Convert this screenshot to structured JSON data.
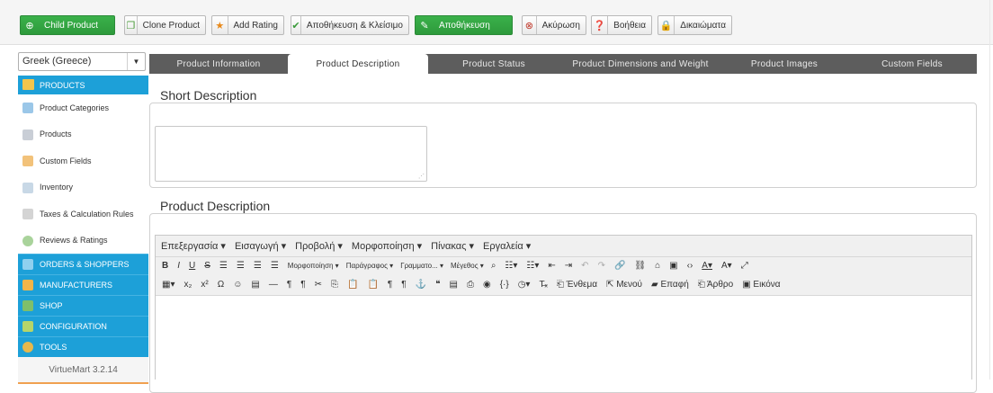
{
  "toolbar": {
    "child_product": "Child Product",
    "clone_product": "Clone Product",
    "add_rating": "Add Rating",
    "save_close": "Αποθήκευση & Κλείσιμο",
    "save": "Αποθήκευση",
    "cancel": "Ακύρωση",
    "help": "Βοήθεια",
    "permissions": "Δικαιώματα"
  },
  "language": {
    "selected": "Greek (Greece)"
  },
  "sidebar": {
    "section_products": "PRODUCTS",
    "items": [
      {
        "label": "Product Categories",
        "icon": "folder-icon"
      },
      {
        "label": "Products",
        "icon": "products-icon"
      },
      {
        "label": "Custom Fields",
        "icon": "custom-fields-icon"
      },
      {
        "label": "Inventory",
        "icon": "inventory-icon"
      },
      {
        "label": "Taxes & Calculation Rules",
        "icon": "calculator-icon"
      },
      {
        "label": "Reviews & Ratings",
        "icon": "reviews-icon"
      }
    ],
    "sections": [
      {
        "label": "ORDERS & SHOPPERS"
      },
      {
        "label": "MANUFACTURERS"
      },
      {
        "label": "SHOP"
      },
      {
        "label": "CONFIGURATION"
      },
      {
        "label": "TOOLS"
      }
    ],
    "version": "VirtueMart 3.2.14"
  },
  "tabs": [
    {
      "label": "Product Information"
    },
    {
      "label": "Product Description"
    },
    {
      "label": "Product Status"
    },
    {
      "label": "Product Dimensions and Weight"
    },
    {
      "label": "Product Images"
    },
    {
      "label": "Custom Fields"
    }
  ],
  "active_tab": "Product Description",
  "sections": {
    "short_description": "Short Description",
    "product_description": "Product Description"
  },
  "editor": {
    "menu": [
      "Επεξεργασία ▾",
      "Εισαγωγή ▾",
      "Προβολή ▾",
      "Μορφοποίηση ▾",
      "Πίνακας ▾",
      "Εργαλεία ▾"
    ],
    "format_dropdown": "Μορφοποίηση ▾",
    "paragraph_dropdown": "Παράγραφος ▾",
    "font_dropdown": "Γραμματο... ▾",
    "size_dropdown": "Μέγεθος ▾",
    "btn_embed": "Ένθεμα",
    "btn_menu": "Μενού",
    "btn_contact": "Επαφή",
    "btn_article": "Άρθρο",
    "btn_image": "Εικόνα"
  },
  "colors": {
    "accent": "#1da0d8",
    "tabbar": "#5d5d5d",
    "green": "#33a544"
  }
}
